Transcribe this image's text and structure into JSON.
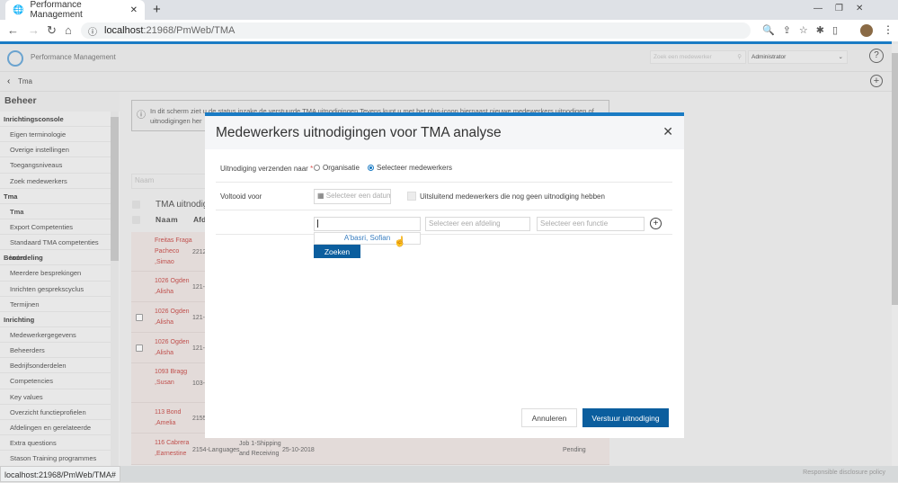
{
  "browser": {
    "tab_title": "Performance Management",
    "url_host": "localhost",
    "url_path": ":21968/PmWeb/TMA",
    "status_url": "localhost:21968/PmWeb/TMA#"
  },
  "app": {
    "title": "Performance Management",
    "search_placeholder": "Zoek een medewerker",
    "role": "Administrator",
    "breadcrumb": "Tma",
    "footer_link": "Responsible disclosure policy"
  },
  "sidebar": {
    "title": "Beheer",
    "items": [
      {
        "label": "Inrichtingsconsole",
        "type": "h"
      },
      {
        "label": "Eigen terminologie",
        "type": "i"
      },
      {
        "label": "Overige instellingen",
        "type": "i"
      },
      {
        "label": "Toegangsniveaus",
        "type": "i"
      },
      {
        "label": "Zoek medewerkers",
        "type": "i"
      },
      {
        "label": "Tma",
        "type": "h"
      },
      {
        "label": "Tma",
        "type": "a"
      },
      {
        "label": "Export Competenties",
        "type": "i"
      },
      {
        "label": "Standaard TMA competenties laden",
        "type": "i"
      },
      {
        "label": "Beoordeling",
        "type": "h"
      },
      {
        "label": "Meerdere besprekingen",
        "type": "i"
      },
      {
        "label": "Inrichten gesprekscyclus",
        "type": "i"
      },
      {
        "label": "Termijnen",
        "type": "i"
      },
      {
        "label": "Inrichting",
        "type": "h"
      },
      {
        "label": "Medewerkergegevens",
        "type": "i"
      },
      {
        "label": "Beheerders",
        "type": "i"
      },
      {
        "label": "Bedrijfsonderdelen",
        "type": "i"
      },
      {
        "label": "Competencies",
        "type": "i"
      },
      {
        "label": "Key values",
        "type": "i"
      },
      {
        "label": "Overzicht functieprofielen",
        "type": "i"
      },
      {
        "label": "Afdelingen en gerelateerde",
        "type": "i"
      },
      {
        "label": "Extra questions",
        "type": "i"
      },
      {
        "label": "Stason Training programmes",
        "type": "i"
      }
    ]
  },
  "main": {
    "info": "In dit scherm ziet u de status inzake de verstuurde TMA uitnodigingen Tevens kunt u met het plus-icoon hiernaast nieuwe medewerkers uitnodigen of",
    "info2": "uitnodigingen her",
    "filter_placeholder": "Naam",
    "table_title": "TMA uitnodigi",
    "col_naam": "Naam",
    "col_afd": "Afd",
    "rows": [
      {
        "name": "Freitas Fraga Pacheco ,Simao",
        "afd": "2212",
        "cb": false
      },
      {
        "name": "1026 Ogden ,Alisha",
        "afd": "121-",
        "cb": false
      },
      {
        "name": "1026 Ogden ,Alisha",
        "afd": "121-",
        "cb": true
      },
      {
        "name": "1026 Ogden ,Alisha",
        "afd": "121-",
        "cb": true
      },
      {
        "name": "1093 Bragg ,Susan",
        "afd": "103-",
        "cb": false
      },
      {
        "name": "113 Bond ,Amelia",
        "afd": "2155",
        "cb": false
      },
      {
        "name": "116 Cabrera ,Earnestine",
        "afd": "2154-Languages",
        "job": "Job 1-Shipping and Receiving",
        "date": "25-10-2018",
        "status": "Pending",
        "cb": false
      }
    ]
  },
  "modal": {
    "title": "Medewerkers uitnodigingen voor TMA analyse",
    "send_to_label": "Uitnodiging verzenden naar",
    "required": "*",
    "opt_org": "Organisatie",
    "opt_sel": "Selecteer medewerkers",
    "completed_label": "Voltooid voor",
    "date_placeholder": "Selecteer een datum",
    "only_new_label": "Uitsluitend medewerkers die nog geen uitnodiging hebben",
    "employee_value": "",
    "suggestion": "A'basri, Sofian",
    "dept_placeholder": "Selecteer een afdeling",
    "func_placeholder": "Selecteer een functie",
    "search_btn": "Zoeken",
    "cancel_btn": "Annuleren",
    "send_btn": "Verstuur uitnodiging"
  }
}
